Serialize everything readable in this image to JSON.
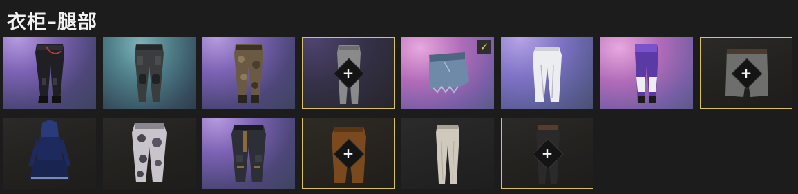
{
  "header": {
    "title": "衣柜–腿部"
  },
  "icons": {
    "plus": "+",
    "check": "✓"
  },
  "items": [
    {
      "name": "black-chain-pants",
      "row": 1,
      "col": 1,
      "background": "purple",
      "locked": false,
      "selected": false
    },
    {
      "name": "gray-armored-pants",
      "row": 1,
      "col": 2,
      "background": "teal",
      "locked": false,
      "selected": false
    },
    {
      "name": "camo-cargo-pants",
      "row": 1,
      "col": 3,
      "background": "purple",
      "locked": false,
      "selected": false
    },
    {
      "name": "gray-slim-pants",
      "row": 1,
      "col": 4,
      "background": "dark-purple",
      "locked": true,
      "selected": false
    },
    {
      "name": "denim-skirt",
      "row": 1,
      "col": 5,
      "background": "pink",
      "locked": false,
      "selected": true
    },
    {
      "name": "white-pants",
      "row": 1,
      "col": 6,
      "background": "lavender",
      "locked": false,
      "selected": false
    },
    {
      "name": "purple-white-pants",
      "row": 1,
      "col": 7,
      "background": "pink",
      "locked": false,
      "selected": false
    },
    {
      "name": "gray-shorts",
      "row": 1,
      "col": 8,
      "background": "dark",
      "locked": true,
      "selected": false
    },
    {
      "name": "blue-hooded-dress",
      "row": 2,
      "col": 1,
      "background": "dark",
      "locked": false,
      "selected": false
    },
    {
      "name": "white-camo-pants",
      "row": 2,
      "col": 2,
      "background": "dark",
      "locked": false,
      "selected": false
    },
    {
      "name": "strapped-combat-pants",
      "row": 2,
      "col": 3,
      "background": "purple",
      "locked": false,
      "selected": false
    },
    {
      "name": "brown-pants",
      "row": 2,
      "col": 4,
      "background": "dark-brown",
      "locked": true,
      "selected": false
    },
    {
      "name": "beige-slim-pants",
      "row": 2,
      "col": 5,
      "background": "dark-gray",
      "locked": false,
      "selected": false
    },
    {
      "name": "black-pants",
      "row": 2,
      "col": 6,
      "background": "dark",
      "locked": true,
      "selected": false
    }
  ],
  "colors": {
    "page_background": "#1c1c1c",
    "title_text": "#f2f2f2",
    "locked_border": "#d8c064",
    "check_mark": "#e4cc5c"
  }
}
